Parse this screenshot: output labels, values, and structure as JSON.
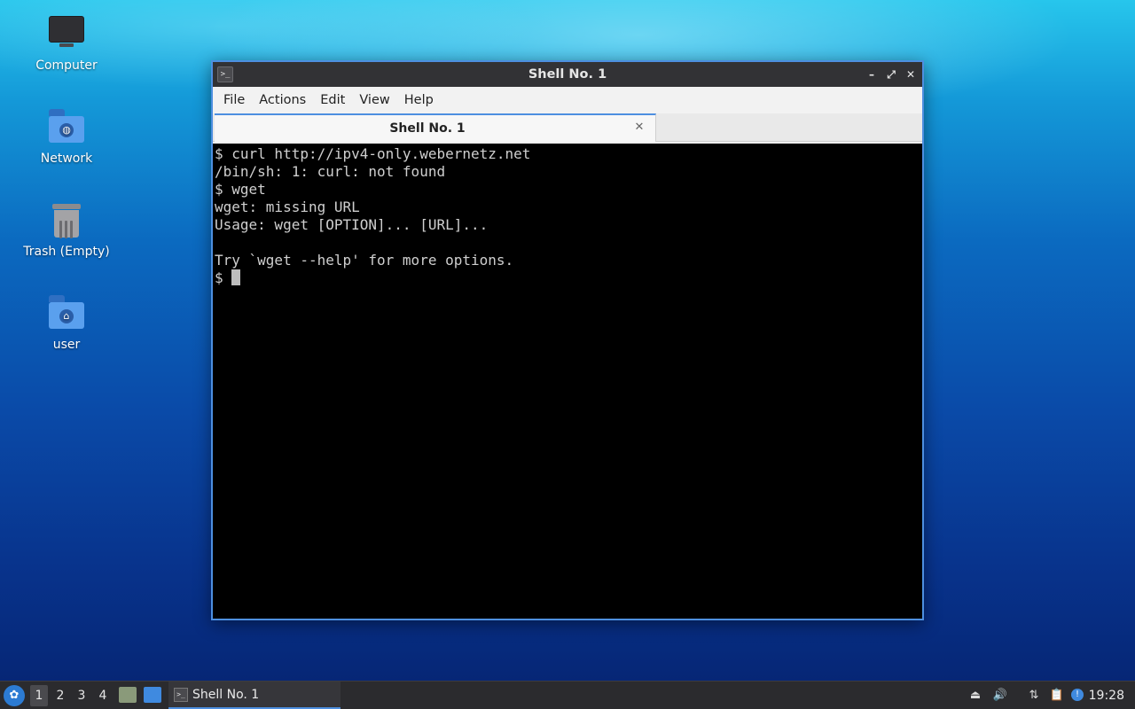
{
  "desktop": {
    "icons": [
      {
        "label": "Computer",
        "icon": "computer-icon"
      },
      {
        "label": "Network",
        "icon": "network-folder-icon"
      },
      {
        "label": "Trash (Empty)",
        "icon": "trash-icon"
      },
      {
        "label": "user",
        "icon": "home-folder-icon"
      }
    ]
  },
  "window": {
    "title": "Shell No. 1",
    "app_icon_glyph": ">_",
    "controls": {
      "minimize": "–",
      "maximize": "⤢",
      "close": "✕"
    },
    "menu": [
      "File",
      "Actions",
      "Edit",
      "View",
      "Help"
    ],
    "tab": {
      "label": "Shell No. 1",
      "close": "✕"
    },
    "terminal": {
      "lines": [
        "$ curl http://ipv4-only.webernetz.net",
        "/bin/sh: 1: curl: not found",
        "$ wget",
        "wget: missing URL",
        "Usage: wget [OPTION]... [URL]...",
        "",
        "Try `wget --help' for more options."
      ],
      "prompt": "$ "
    },
    "accent_color": "#4d8fe0"
  },
  "taskbar": {
    "start_icon": "lubuntu-logo-icon",
    "workspaces": [
      "1",
      "2",
      "3",
      "4"
    ],
    "active_workspace": "1",
    "task": {
      "label": "Shell No. 1",
      "icon_glyph": ">_"
    },
    "tray": {
      "eject": "⏏",
      "volume": "🔊",
      "network": "⇅",
      "clipboard": "📋",
      "updates": "!"
    },
    "clock": "19:28"
  }
}
